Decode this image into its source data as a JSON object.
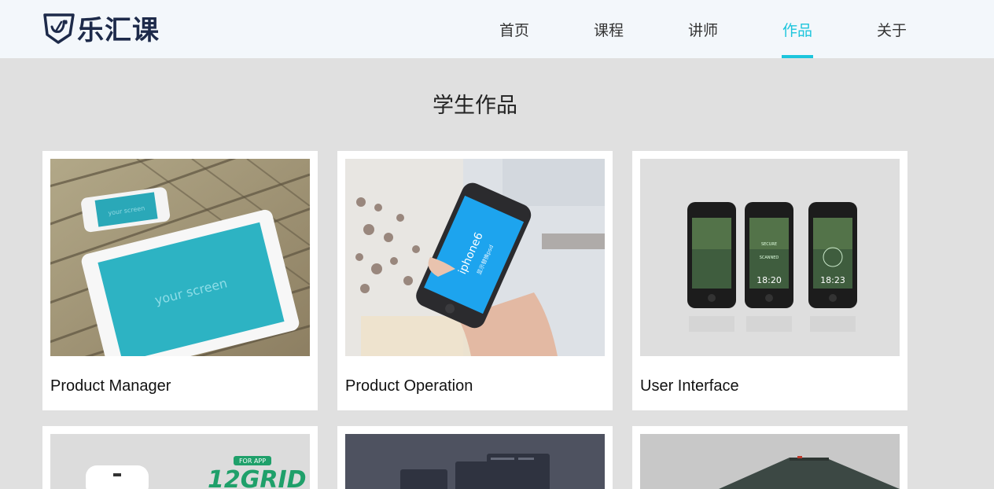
{
  "brand": {
    "name": "乐汇课"
  },
  "nav": {
    "items": [
      {
        "label": "首页"
      },
      {
        "label": "课程"
      },
      {
        "label": "讲师"
      },
      {
        "label": "作品"
      },
      {
        "label": "关于"
      }
    ],
    "active": "作品"
  },
  "section": {
    "title": "学生作品"
  },
  "works": [
    {
      "title": "Product Manager",
      "screen_text": "your screen",
      "small_screen_text": "your screen"
    },
    {
      "title": "Product Operation",
      "screen_text": "iphone6",
      "screen_subtext": "显示替换psd"
    },
    {
      "title": "User Interface",
      "phone_times": [
        "18:20",
        "18:23"
      ],
      "phone_labels": [
        "SECURE",
        "SCANNED"
      ]
    },
    {
      "title": "",
      "graphic_text": "12GRID",
      "graphic_badge": "FOR APP"
    },
    {
      "title": ""
    },
    {
      "title": ""
    }
  ],
  "colors": {
    "accent": "#1cc5dc",
    "brand": "#1d2a4a",
    "background": "#e0e0e0"
  }
}
